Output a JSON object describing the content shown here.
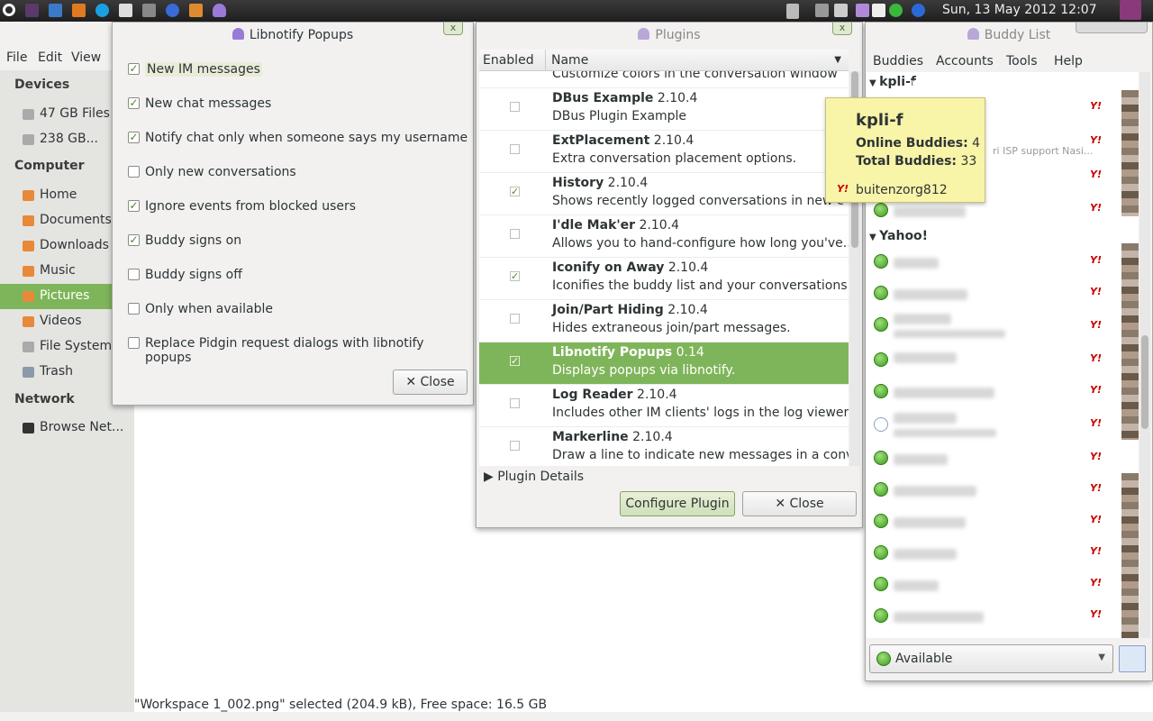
{
  "panel": {
    "clock": "Sun, 13 May 2012 12:07"
  },
  "file_manager": {
    "menus": [
      "File",
      "Edit",
      "View"
    ],
    "sidebar": {
      "devices_header": "Devices",
      "devices": [
        "47 GB Files",
        "238 GB..."
      ],
      "computer_header": "Computer",
      "computer": [
        "Home",
        "Documents",
        "Downloads",
        "Music",
        "Pictures",
        "Videos",
        "File System",
        "Trash"
      ],
      "selected": "Pictures",
      "network_header": "Network",
      "network": [
        "Browse Net..."
      ]
    },
    "status": "\"Workspace 1_002.png\" selected (204.9 kB), Free space: 16.5 GB"
  },
  "libnotify": {
    "title": "Libnotify Popups",
    "close_x": "x",
    "options": [
      {
        "label": "New IM messages",
        "checked": true
      },
      {
        "label": "New chat messages",
        "checked": true
      },
      {
        "label": "Notify chat only when someone says my username",
        "checked": true
      },
      {
        "label": "Only new conversations",
        "checked": false
      },
      {
        "label": "Ignore events from blocked users",
        "checked": true
      },
      {
        "label": "Buddy signs on",
        "checked": true
      },
      {
        "label": "Buddy signs off",
        "checked": false
      },
      {
        "label": "Only when available",
        "checked": false
      },
      {
        "label": "Replace Pidgin request dialogs with libnotify popups",
        "checked": false
      }
    ],
    "close_label": "Close"
  },
  "plugins": {
    "title": "Plugins",
    "close_x": "x",
    "col_enabled": "Enabled",
    "col_name": "Name",
    "partial_top": "Customize colors in the conversation window",
    "rows": [
      {
        "name": "DBus Example",
        "version": "2.10.4",
        "desc": "DBus Plugin Example",
        "enabled": false
      },
      {
        "name": "ExtPlacement",
        "version": "2.10.4",
        "desc": "Extra conversation placement options.",
        "enabled": false
      },
      {
        "name": "History",
        "version": "2.10.4",
        "desc": "Shows recently logged conversations in new c",
        "enabled": true
      },
      {
        "name": "I'dle Mak'er",
        "version": "2.10.4",
        "desc": "Allows you to hand-configure how long you've...",
        "enabled": false
      },
      {
        "name": "Iconify on Away",
        "version": "2.10.4",
        "desc": "Iconifies the buddy list and your conversations...",
        "enabled": true
      },
      {
        "name": "Join/Part Hiding",
        "version": "2.10.4",
        "desc": "Hides extraneous join/part messages.",
        "enabled": false
      },
      {
        "name": "Libnotify Popups",
        "version": "0.14",
        "desc": "Displays popups via libnotify.",
        "enabled": true,
        "selected": true
      },
      {
        "name": "Log Reader",
        "version": "2.10.4",
        "desc": "Includes other IM clients' logs in the log viewer.",
        "enabled": false
      },
      {
        "name": "Markerline",
        "version": "2.10.4",
        "desc": "Draw a line to indicate new messages in a conv...",
        "enabled": false
      }
    ],
    "details_label": "Plugin Details",
    "configure_label": "Configure Plugin",
    "close_label": "Close"
  },
  "buddy_list": {
    "title": "Buddy List",
    "menus": [
      "Buddies",
      "Accounts",
      "Tools",
      "Help"
    ],
    "group1": "kpli-f",
    "group1_status_snippet": "ri ISP support Nasi...",
    "group2": "Yahoo!",
    "status": "Available",
    "protocol_icon": "Y!"
  },
  "tooltip": {
    "name": "kpli-f",
    "online_label": "Online Buddies:",
    "online_value": "4",
    "total_label": "Total Buddies:",
    "total_value": "33",
    "account": "buitenzorg812"
  }
}
